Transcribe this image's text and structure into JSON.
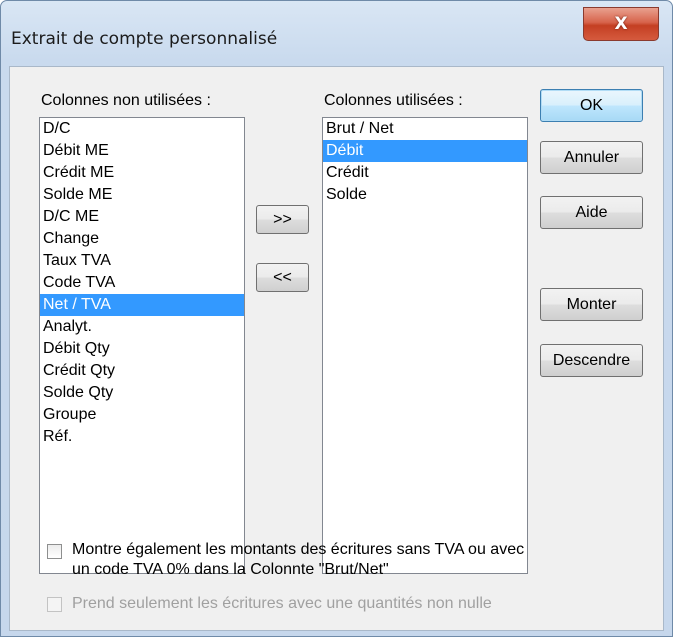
{
  "window": {
    "title": "Extrait de compte personnalisé",
    "close_glyph": "X"
  },
  "unused_columns": {
    "label": "Colonnes non utilisées :",
    "items": [
      "D/C",
      "Débit ME",
      "Crédit ME",
      "Solde ME",
      "D/C ME",
      "Change",
      "Taux TVA",
      "Code TVA",
      "Net / TVA",
      "Analyt.",
      "Débit Qty",
      "Crédit Qty",
      "Solde Qty",
      "Groupe",
      "Réf."
    ],
    "selected": "Net / TVA"
  },
  "used_columns": {
    "label": "Colonnes utilisées :",
    "items": [
      "Brut / Net",
      "Débit",
      "Crédit",
      "Solde"
    ],
    "selected": "Débit"
  },
  "transfer": {
    "add_label": ">>",
    "remove_label": "<<"
  },
  "buttons": {
    "ok": "OK",
    "cancel": "Annuler",
    "help": "Aide",
    "up": "Monter",
    "down": "Descendre"
  },
  "options": {
    "show_no_vat": {
      "line1": "Montre également les montants des écritures sans TVA ou avec",
      "line2": "un code TVA 0% dans la Colonnte \"Brut/Net\"",
      "checked": false
    },
    "nonzero_qty": {
      "label": "Prend seulement les écritures avec une quantités non nulle",
      "checked": false,
      "enabled": false
    }
  }
}
